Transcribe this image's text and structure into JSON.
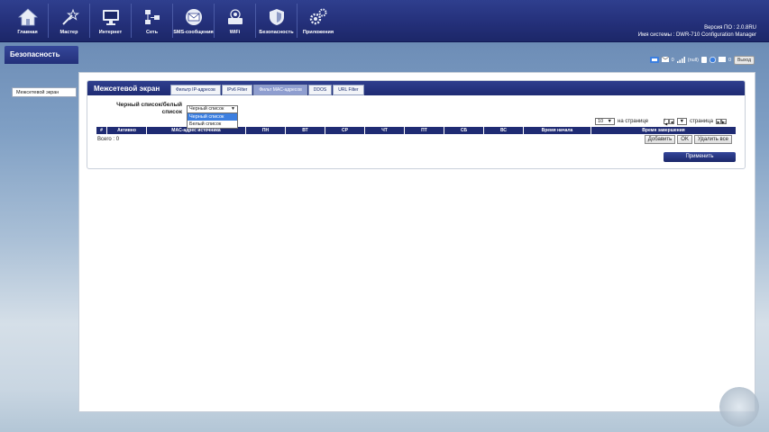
{
  "nav": [
    {
      "label": "Главная",
      "icon": "home-icon"
    },
    {
      "label": "Мастер",
      "icon": "wizard-icon"
    },
    {
      "label": "Интернет",
      "icon": "monitor-icon"
    },
    {
      "label": "Сеть",
      "icon": "network-icon"
    },
    {
      "label": "SMS-сообщения",
      "icon": "envelope-icon"
    },
    {
      "label": "WiFi",
      "icon": "wifi-icon"
    },
    {
      "label": "Безопасность",
      "icon": "shield-icon"
    },
    {
      "label": "Приложения",
      "icon": "gears-icon"
    }
  ],
  "info": {
    "firmware": "Версия ПО : 2.0.8RU",
    "system": "Имя системы : DWR-710 Configuration Manager"
  },
  "section": "Безопасность",
  "status": {
    "mail_count": "0",
    "signal": "(null)",
    "sms_count": "0",
    "logout": "Выход"
  },
  "sidebar": {
    "item": "Межсетевой экран"
  },
  "card": {
    "title": "Межсетевой экран",
    "tabs": [
      {
        "label": "Фильтр IP-адресов",
        "active": false
      },
      {
        "label": "IPv6 Filter",
        "active": false
      },
      {
        "label": "Фильт MAC-адресов",
        "active": true
      },
      {
        "label": "DDOS",
        "active": false
      },
      {
        "label": "URL Filter",
        "active": false
      }
    ]
  },
  "form": {
    "label": "Черный список/белый список",
    "selected": "Черный список",
    "options": [
      "Черный список",
      "Белый список"
    ]
  },
  "paging": {
    "per_page_value": "10",
    "per_page_label": "на странице",
    "page_value": "",
    "page_label": "страница"
  },
  "table": {
    "columns": [
      "#",
      "Активно",
      "MAC-адрес источника",
      "ПН",
      "ВТ",
      "СР",
      "ЧТ",
      "ПТ",
      "СБ",
      "ВС",
      "Время начала",
      "Время завершения"
    ],
    "total": "Всего : 0"
  },
  "buttons": {
    "add": "Добавить",
    "ok": "OK",
    "delete_all": "Удалить все",
    "apply": "Применить"
  },
  "colors": {
    "header": "#24307a",
    "accent": "#3c7fe0",
    "active_tab": "#8f9ed0"
  }
}
